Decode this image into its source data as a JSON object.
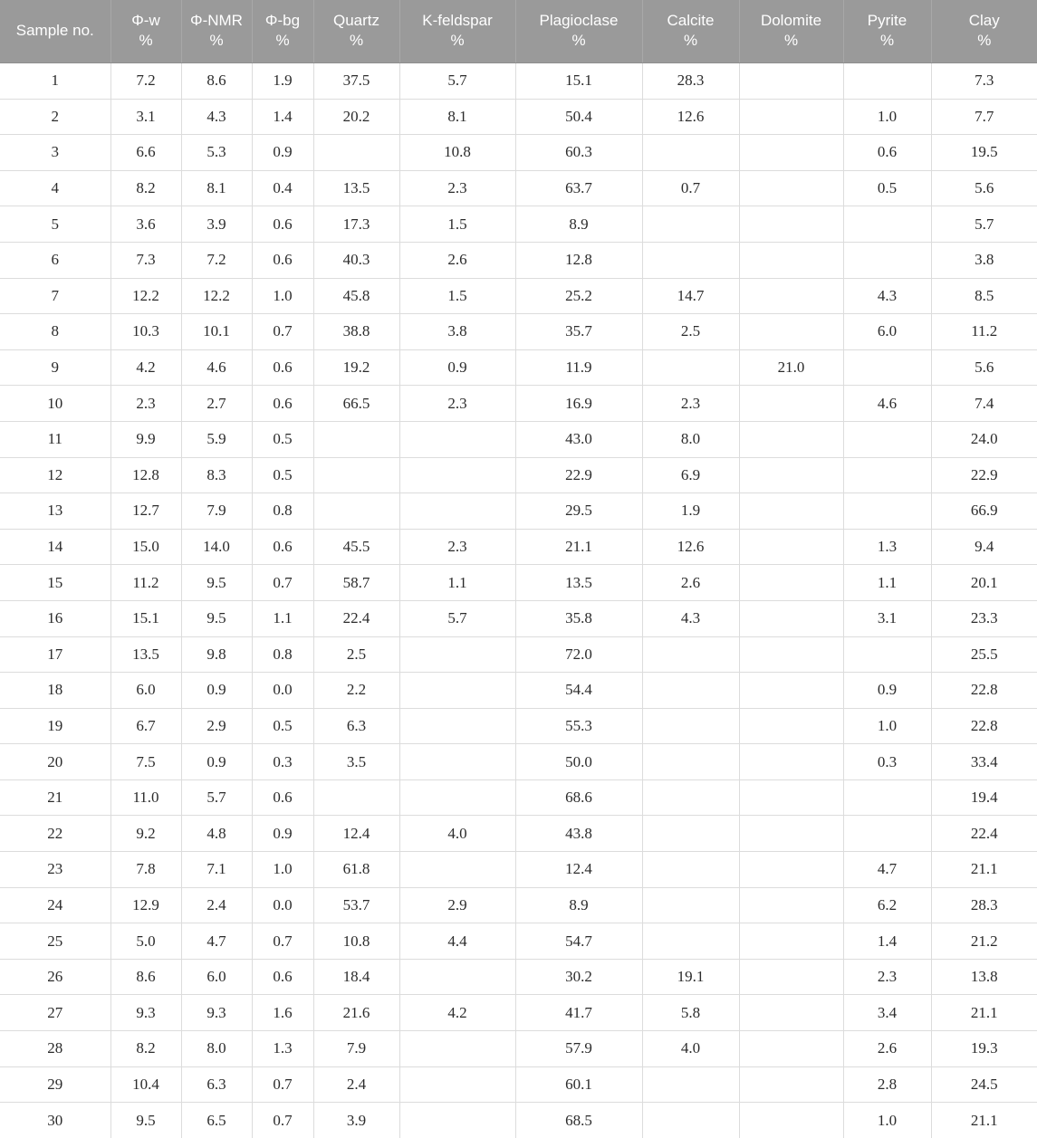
{
  "table": {
    "columns": [
      {
        "name": "Sample no.",
        "unit": "",
        "key": "sample"
      },
      {
        "name": "Φ-w",
        "unit": "%",
        "key": "phi_w"
      },
      {
        "name": "Φ-NMR",
        "unit": "%",
        "key": "phi_nmr"
      },
      {
        "name": "Φ-bg",
        "unit": "%",
        "key": "phi_bg"
      },
      {
        "name": "Quartz",
        "unit": "%",
        "key": "quartz"
      },
      {
        "name": "K-feldspar",
        "unit": "%",
        "key": "k_feldspar"
      },
      {
        "name": "Plagioclase",
        "unit": "%",
        "key": "plagioclase"
      },
      {
        "name": "Calcite",
        "unit": "%",
        "key": "calcite"
      },
      {
        "name": "Dolomite",
        "unit": "%",
        "key": "dolomite"
      },
      {
        "name": "Pyrite",
        "unit": "%",
        "key": "pyrite"
      },
      {
        "name": "Clay",
        "unit": "%",
        "key": "clay"
      }
    ],
    "header_background": "#9a9a9a",
    "header_text_color": "#ffffff",
    "body_text_color": "#2b2b2b",
    "row_line_color": "#dcdcdc",
    "rows": [
      [
        "1",
        "7.2",
        "8.6",
        "1.9",
        "37.5",
        "5.7",
        "15.1",
        "28.3",
        "",
        "",
        "7.3"
      ],
      [
        "2",
        "3.1",
        "4.3",
        "1.4",
        "20.2",
        "8.1",
        "50.4",
        "12.6",
        "",
        "1.0",
        "7.7"
      ],
      [
        "3",
        "6.6",
        "5.3",
        "0.9",
        "",
        "10.8",
        "60.3",
        "",
        "",
        "0.6",
        "19.5"
      ],
      [
        "4",
        "8.2",
        "8.1",
        "0.4",
        "13.5",
        "2.3",
        "63.7",
        "0.7",
        "",
        "0.5",
        "5.6"
      ],
      [
        "5",
        "3.6",
        "3.9",
        "0.6",
        "17.3",
        "1.5",
        "8.9",
        "",
        "",
        "",
        "5.7"
      ],
      [
        "6",
        "7.3",
        "7.2",
        "0.6",
        "40.3",
        "2.6",
        "12.8",
        "",
        "",
        "",
        "3.8"
      ],
      [
        "7",
        "12.2",
        "12.2",
        "1.0",
        "45.8",
        "1.5",
        "25.2",
        "14.7",
        "",
        "4.3",
        "8.5"
      ],
      [
        "8",
        "10.3",
        "10.1",
        "0.7",
        "38.8",
        "3.8",
        "35.7",
        "2.5",
        "",
        "6.0",
        "11.2"
      ],
      [
        "9",
        "4.2",
        "4.6",
        "0.6",
        "19.2",
        "0.9",
        "11.9",
        "",
        "21.0",
        "",
        "5.6"
      ],
      [
        "10",
        "2.3",
        "2.7",
        "0.6",
        "66.5",
        "2.3",
        "16.9",
        "2.3",
        "",
        "4.6",
        "7.4"
      ],
      [
        "11",
        "9.9",
        "5.9",
        "0.5",
        "",
        "",
        "43.0",
        "8.0",
        "",
        "",
        "24.0"
      ],
      [
        "12",
        "12.8",
        "8.3",
        "0.5",
        "",
        "",
        "22.9",
        "6.9",
        "",
        "",
        "22.9"
      ],
      [
        "13",
        "12.7",
        "7.9",
        "0.8",
        "",
        "",
        "29.5",
        "1.9",
        "",
        "",
        "66.9"
      ],
      [
        "14",
        "15.0",
        "14.0",
        "0.6",
        "45.5",
        "2.3",
        "21.1",
        "12.6",
        "",
        "1.3",
        "9.4"
      ],
      [
        "15",
        "11.2",
        "9.5",
        "0.7",
        "58.7",
        "1.1",
        "13.5",
        "2.6",
        "",
        "1.1",
        "20.1"
      ],
      [
        "16",
        "15.1",
        "9.5",
        "1.1",
        "22.4",
        "5.7",
        "35.8",
        "4.3",
        "",
        "3.1",
        "23.3"
      ],
      [
        "17",
        "13.5",
        "9.8",
        "0.8",
        "2.5",
        "",
        "72.0",
        "",
        "",
        "",
        "25.5"
      ],
      [
        "18",
        "6.0",
        "0.9",
        "0.0",
        "2.2",
        "",
        "54.4",
        "",
        "",
        "0.9",
        "22.8"
      ],
      [
        "19",
        "6.7",
        "2.9",
        "0.5",
        "6.3",
        "",
        "55.3",
        "",
        "",
        "1.0",
        "22.8"
      ],
      [
        "20",
        "7.5",
        "0.9",
        "0.3",
        "3.5",
        "",
        "50.0",
        "",
        "",
        "0.3",
        "33.4"
      ],
      [
        "21",
        "11.0",
        "5.7",
        "0.6",
        "",
        "",
        "68.6",
        "",
        "",
        "",
        "19.4"
      ],
      [
        "22",
        "9.2",
        "4.8",
        "0.9",
        "12.4",
        "4.0",
        "43.8",
        "",
        "",
        "",
        "22.4"
      ],
      [
        "23",
        "7.8",
        "7.1",
        "1.0",
        "61.8",
        "",
        "12.4",
        "",
        "",
        "4.7",
        "21.1"
      ],
      [
        "24",
        "12.9",
        "2.4",
        "0.0",
        "53.7",
        "2.9",
        "8.9",
        "",
        "",
        "6.2",
        "28.3"
      ],
      [
        "25",
        "5.0",
        "4.7",
        "0.7",
        "10.8",
        "4.4",
        "54.7",
        "",
        "",
        "1.4",
        "21.2"
      ],
      [
        "26",
        "8.6",
        "6.0",
        "0.6",
        "18.4",
        "",
        "30.2",
        "19.1",
        "",
        "2.3",
        "13.8"
      ],
      [
        "27",
        "9.3",
        "9.3",
        "1.6",
        "21.6",
        "4.2",
        "41.7",
        "5.8",
        "",
        "3.4",
        "21.1"
      ],
      [
        "28",
        "8.2",
        "8.0",
        "1.3",
        "7.9",
        "",
        "57.9",
        "4.0",
        "",
        "2.6",
        "19.3"
      ],
      [
        "29",
        "10.4",
        "6.3",
        "0.7",
        "2.4",
        "",
        "60.1",
        "",
        "",
        "2.8",
        "24.5"
      ],
      [
        "30",
        "9.5",
        "6.5",
        "0.7",
        "3.9",
        "",
        "68.5",
        "",
        "",
        "1.0",
        "21.1"
      ]
    ]
  }
}
